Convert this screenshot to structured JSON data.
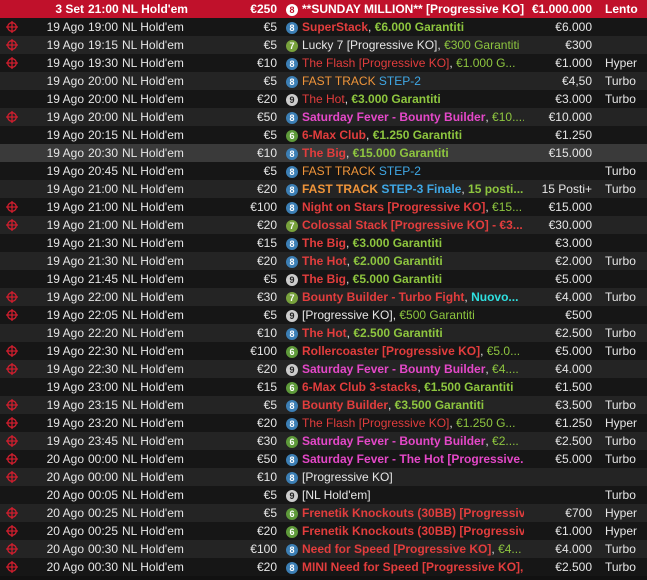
{
  "colors": {
    "selected_row": "#c0112b",
    "badge_8": "#3c7fb5",
    "badge_9": "#cccccc",
    "badge_7": "#78a23c",
    "badge_6": "#5e9a3a",
    "red": "#e23d3d",
    "green": "#8ec63f",
    "pink": "#e548c9",
    "blue": "#3fa8e6",
    "orange": "#f0953a",
    "cyan": "#2ee0e0"
  },
  "rows": [
    {
      "icon": false,
      "date": "3 Set",
      "time": "21:00",
      "game": "NL Hold'em",
      "buyin": "€250",
      "seats": "8",
      "name": [
        {
          "t": "**SUNDAY MILLION** [Progressive KO],",
          "c": "white",
          "b": true
        }
      ],
      "prize": "€1.000.000",
      "speed": "Lento",
      "style": "sel"
    },
    {
      "icon": true,
      "date": "19 Ago",
      "time": "19:00",
      "game": "NL Hold'em",
      "buyin": "€5",
      "seats": "8",
      "name": [
        {
          "t": "SuperStack",
          "c": "red",
          "b": true
        },
        {
          "t": ", ",
          "c": "white"
        },
        {
          "t": "€6.000 Garantiti",
          "c": "green",
          "b": true
        }
      ],
      "prize": "€6.000",
      "speed": "",
      "style": "r1"
    },
    {
      "icon": true,
      "date": "19 Ago",
      "time": "19:15",
      "game": "NL Hold'em",
      "buyin": "€5",
      "seats": "7",
      "name": [
        {
          "t": "Lucky 7 [Progressive KO], ",
          "c": "white"
        },
        {
          "t": "€300 Garantiti",
          "c": "green"
        }
      ],
      "prize": "€300",
      "speed": "",
      "style": "r0"
    },
    {
      "icon": true,
      "date": "19 Ago",
      "time": "19:30",
      "game": "NL Hold'em",
      "buyin": "€10",
      "seats": "8",
      "name": [
        {
          "t": "The Flash [Progressive KO]",
          "c": "red"
        },
        {
          "t": ", ",
          "c": "white"
        },
        {
          "t": "€1.000 G...",
          "c": "green"
        }
      ],
      "prize": "€1.000",
      "speed": "Hyper",
      "style": "r1"
    },
    {
      "icon": false,
      "date": "19 Ago",
      "time": "20:00",
      "game": "NL Hold'em",
      "buyin": "€5",
      "seats": "8",
      "name": [
        {
          "t": "FAST TRACK ",
          "c": "orange"
        },
        {
          "t": "STEP-2",
          "c": "blue"
        }
      ],
      "prize": "€4,50",
      "speed": "Turbo",
      "style": "r0"
    },
    {
      "icon": false,
      "date": "19 Ago",
      "time": "20:00",
      "game": "NL Hold'em",
      "buyin": "€20",
      "seats": "9",
      "name": [
        {
          "t": "The Hot",
          "c": "red"
        },
        {
          "t": ", ",
          "c": "white"
        },
        {
          "t": "€3.000 Garantiti",
          "c": "green",
          "b": true
        }
      ],
      "prize": "€3.000",
      "speed": "Turbo",
      "style": "r1"
    },
    {
      "icon": true,
      "date": "19 Ago",
      "time": "20:00",
      "game": "NL Hold'em",
      "buyin": "€50",
      "seats": "8",
      "name": [
        {
          "t": "Saturday Fever - Bounty Builder",
          "c": "pink",
          "b": true
        },
        {
          "t": ", ",
          "c": "white"
        },
        {
          "t": "€10....",
          "c": "green"
        }
      ],
      "prize": "€10.000",
      "speed": "",
      "style": "r0"
    },
    {
      "icon": false,
      "date": "19 Ago",
      "time": "20:15",
      "game": "NL Hold'em",
      "buyin": "€5",
      "seats": "6",
      "name": [
        {
          "t": "6-Max Club",
          "c": "red",
          "b": true
        },
        {
          "t": ", ",
          "c": "white"
        },
        {
          "t": "€1.250 Garantiti",
          "c": "green",
          "b": true
        }
      ],
      "prize": "€1.250",
      "speed": "",
      "style": "r1"
    },
    {
      "icon": false,
      "date": "19 Ago",
      "time": "20:30",
      "game": "NL Hold'em",
      "buyin": "€10",
      "seats": "8",
      "name": [
        {
          "t": "The Big",
          "c": "red",
          "b": true
        },
        {
          "t": ", ",
          "c": "white"
        },
        {
          "t": "€15.000 Garantiti",
          "c": "green",
          "b": true
        }
      ],
      "prize": "€15.000",
      "speed": "",
      "style": "hl"
    },
    {
      "icon": false,
      "date": "19 Ago",
      "time": "20:45",
      "game": "NL Hold'em",
      "buyin": "€5",
      "seats": "8",
      "name": [
        {
          "t": "FAST TRACK ",
          "c": "orange"
        },
        {
          "t": "STEP-2",
          "c": "blue"
        }
      ],
      "prize": "",
      "speed": "Turbo",
      "style": "r1"
    },
    {
      "icon": false,
      "date": "19 Ago",
      "time": "21:00",
      "game": "NL Hold'em",
      "buyin": "€20",
      "seats": "8",
      "name": [
        {
          "t": "FAST TRACK ",
          "c": "orange",
          "b": true
        },
        {
          "t": "STEP-3 Finale",
          "c": "blue",
          "b": true
        },
        {
          "t": ", ",
          "c": "white"
        },
        {
          "t": "15 posti...",
          "c": "green",
          "b": true
        }
      ],
      "prize": "15 Posti+",
      "speed": "Turbo",
      "style": "r0"
    },
    {
      "icon": true,
      "date": "19 Ago",
      "time": "21:00",
      "game": "NL Hold'em",
      "buyin": "€100",
      "seats": "8",
      "name": [
        {
          "t": "Night on Stars [Progressive KO]",
          "c": "red",
          "b": true
        },
        {
          "t": ", ",
          "c": "white"
        },
        {
          "t": "€15...",
          "c": "green"
        }
      ],
      "prize": "€15.000",
      "speed": "",
      "style": "r1"
    },
    {
      "icon": true,
      "date": "19 Ago",
      "time": "21:00",
      "game": "NL Hold'em",
      "buyin": "€20",
      "seats": "7",
      "name": [
        {
          "t": "Colossal Stack [Progressive KO] - €3...",
          "c": "red",
          "b": true
        }
      ],
      "prize": "€30.000",
      "speed": "",
      "style": "r0"
    },
    {
      "icon": false,
      "date": "19 Ago",
      "time": "21:30",
      "game": "NL Hold'em",
      "buyin": "€15",
      "seats": "8",
      "name": [
        {
          "t": "The Big",
          "c": "red",
          "b": true
        },
        {
          "t": ", ",
          "c": "white"
        },
        {
          "t": "€3.000 Garantiti",
          "c": "green",
          "b": true
        }
      ],
      "prize": "€3.000",
      "speed": "",
      "style": "r1"
    },
    {
      "icon": false,
      "date": "19 Ago",
      "time": "21:30",
      "game": "NL Hold'em",
      "buyin": "€20",
      "seats": "8",
      "name": [
        {
          "t": "The Hot",
          "c": "red",
          "b": true
        },
        {
          "t": ", ",
          "c": "white"
        },
        {
          "t": "€2.000 Garantiti",
          "c": "green",
          "b": true
        }
      ],
      "prize": "€2.000",
      "speed": "Turbo",
      "style": "r0"
    },
    {
      "icon": false,
      "date": "19 Ago",
      "time": "21:45",
      "game": "NL Hold'em",
      "buyin": "€5",
      "seats": "9",
      "name": [
        {
          "t": "The Big",
          "c": "red",
          "b": true
        },
        {
          "t": ", ",
          "c": "white"
        },
        {
          "t": "€5.000 Garantiti",
          "c": "green",
          "b": true
        }
      ],
      "prize": "€5.000",
      "speed": "",
      "style": "r1"
    },
    {
      "icon": true,
      "date": "19 Ago",
      "time": "22:00",
      "game": "NL Hold'em",
      "buyin": "€30",
      "seats": "7",
      "name": [
        {
          "t": "Bounty Builder - Turbo Fight",
          "c": "red",
          "b": true
        },
        {
          "t": ", ",
          "c": "white"
        },
        {
          "t": "Nuovo...",
          "c": "cyan",
          "b": true
        }
      ],
      "prize": "€4.000",
      "speed": "Turbo",
      "style": "r0"
    },
    {
      "icon": true,
      "date": "19 Ago",
      "time": "22:05",
      "game": "NL Hold'em",
      "buyin": "€5",
      "seats": "9",
      "name": [
        {
          "t": "[Progressive KO], ",
          "c": "white"
        },
        {
          "t": "€500 Garantiti",
          "c": "green"
        }
      ],
      "prize": "€500",
      "speed": "",
      "style": "r1"
    },
    {
      "icon": false,
      "date": "19 Ago",
      "time": "22:20",
      "game": "NL Hold'em",
      "buyin": "€10",
      "seats": "8",
      "name": [
        {
          "t": "The Hot",
          "c": "red",
          "b": true
        },
        {
          "t": ", ",
          "c": "white"
        },
        {
          "t": "€2.500 Garantiti",
          "c": "green",
          "b": true
        }
      ],
      "prize": "€2.500",
      "speed": "Turbo",
      "style": "r0"
    },
    {
      "icon": true,
      "date": "19 Ago",
      "time": "22:30",
      "game": "NL Hold'em",
      "buyin": "€100",
      "seats": "6",
      "name": [
        {
          "t": "Rollercoaster [Progressive KO]",
          "c": "red",
          "b": true
        },
        {
          "t": ", ",
          "c": "white"
        },
        {
          "t": "€5.0...",
          "c": "green"
        }
      ],
      "prize": "€5.000",
      "speed": "Turbo",
      "style": "r1"
    },
    {
      "icon": true,
      "date": "19 Ago",
      "time": "22:30",
      "game": "NL Hold'em",
      "buyin": "€20",
      "seats": "9",
      "name": [
        {
          "t": "Saturday Fever - Bounty Builder",
          "c": "pink",
          "b": true
        },
        {
          "t": ", ",
          "c": "white"
        },
        {
          "t": "€4....",
          "c": "green"
        }
      ],
      "prize": "€4.000",
      "speed": "",
      "style": "r0"
    },
    {
      "icon": false,
      "date": "19 Ago",
      "time": "23:00",
      "game": "NL Hold'em",
      "buyin": "€15",
      "seats": "6",
      "name": [
        {
          "t": "6-Max Club 3-stacks",
          "c": "red",
          "b": true
        },
        {
          "t": ", ",
          "c": "white"
        },
        {
          "t": "€1.500 Garantiti",
          "c": "green",
          "b": true
        }
      ],
      "prize": "€1.500",
      "speed": "",
      "style": "r1"
    },
    {
      "icon": true,
      "date": "19 Ago",
      "time": "23:15",
      "game": "NL Hold'em",
      "buyin": "€5",
      "seats": "8",
      "name": [
        {
          "t": "Bounty Builder",
          "c": "red",
          "b": true
        },
        {
          "t": ", ",
          "c": "white"
        },
        {
          "t": "€3.500 Garantiti",
          "c": "green",
          "b": true
        }
      ],
      "prize": "€3.500",
      "speed": "Turbo",
      "style": "r0"
    },
    {
      "icon": true,
      "date": "19 Ago",
      "time": "23:20",
      "game": "NL Hold'em",
      "buyin": "€20",
      "seats": "8",
      "name": [
        {
          "t": "The Flash [Progressive KO]",
          "c": "red"
        },
        {
          "t": ", ",
          "c": "white"
        },
        {
          "t": "€1.250 G...",
          "c": "green"
        }
      ],
      "prize": "€1.250",
      "speed": "Hyper",
      "style": "r1"
    },
    {
      "icon": true,
      "date": "19 Ago",
      "time": "23:45",
      "game": "NL Hold'em",
      "buyin": "€30",
      "seats": "6",
      "name": [
        {
          "t": "Saturday Fever - Bounty Builder",
          "c": "pink",
          "b": true
        },
        {
          "t": ", ",
          "c": "white"
        },
        {
          "t": "€2....",
          "c": "green"
        }
      ],
      "prize": "€2.500",
      "speed": "Turbo",
      "style": "r0"
    },
    {
      "icon": true,
      "date": "20 Ago",
      "time": "00:00",
      "game": "NL Hold'em",
      "buyin": "€50",
      "seats": "8",
      "name": [
        {
          "t": "Saturday Fever - The Hot [Progressive...",
          "c": "pink",
          "b": true
        }
      ],
      "prize": "€5.000",
      "speed": "Turbo",
      "style": "r1"
    },
    {
      "icon": true,
      "date": "20 Ago",
      "time": "00:00",
      "game": "NL Hold'em",
      "buyin": "€10",
      "seats": "8",
      "name": [
        {
          "t": "[Progressive KO]",
          "c": "white"
        }
      ],
      "prize": "",
      "speed": "",
      "style": "r0"
    },
    {
      "icon": false,
      "date": "20 Ago",
      "time": "00:05",
      "game": "NL Hold'em",
      "buyin": "€5",
      "seats": "9",
      "name": [
        {
          "t": "[NL Hold'em]",
          "c": "white"
        }
      ],
      "prize": "",
      "speed": "Turbo",
      "style": "r1"
    },
    {
      "icon": true,
      "date": "20 Ago",
      "time": "00:25",
      "game": "NL Hold'em",
      "buyin": "€5",
      "seats": "6",
      "name": [
        {
          "t": "Frenetik Knockouts (30BB) [Progressive...",
          "c": "red",
          "b": true
        }
      ],
      "prize": "€700",
      "speed": "Hyper",
      "style": "r0"
    },
    {
      "icon": true,
      "date": "20 Ago",
      "time": "00:25",
      "game": "NL Hold'em",
      "buyin": "€20",
      "seats": "6",
      "name": [
        {
          "t": "Frenetik Knockouts (30BB) [Progressive...",
          "c": "red",
          "b": true
        }
      ],
      "prize": "€1.000",
      "speed": "Hyper",
      "style": "r1"
    },
    {
      "icon": true,
      "date": "20 Ago",
      "time": "00:30",
      "game": "NL Hold'em",
      "buyin": "€100",
      "seats": "8",
      "name": [
        {
          "t": "Need for Speed [Progressive KO]",
          "c": "red",
          "b": true
        },
        {
          "t": ", ",
          "c": "white"
        },
        {
          "t": "€4...",
          "c": "green"
        }
      ],
      "prize": "€4.000",
      "speed": "Turbo",
      "style": "r0"
    },
    {
      "icon": true,
      "date": "20 Ago",
      "time": "00:30",
      "game": "NL Hold'em",
      "buyin": "€20",
      "seats": "8",
      "name": [
        {
          "t": "MINI Need for Speed [Progressive KO],",
          "c": "red",
          "b": true
        }
      ],
      "prize": "€2.500",
      "speed": "Turbo",
      "style": "r1"
    }
  ]
}
